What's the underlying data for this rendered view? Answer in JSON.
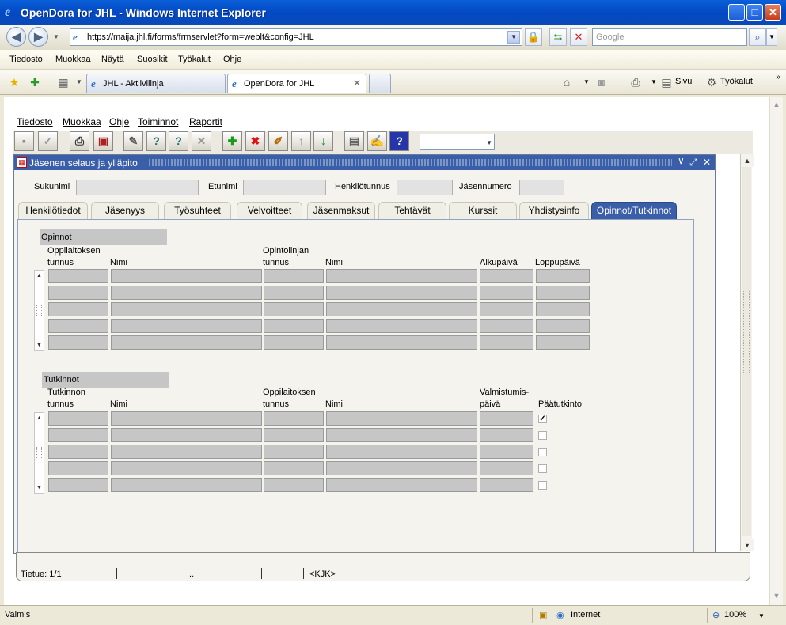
{
  "window": {
    "title": "OpenDora for JHL - Windows Internet Explorer"
  },
  "address": {
    "url": "https://maija.jhl.fi/forms/frmservlet?form=weblt&config=JHL",
    "search_placeholder": "Google"
  },
  "ie_menu": [
    "Tiedosto",
    "Muokkaa",
    "Näytä",
    "Suosikit",
    "Työkalut",
    "Ohje"
  ],
  "browser_tabs": [
    {
      "label": "JHL - Aktiivilinja"
    },
    {
      "label": "OpenDora for JHL"
    }
  ],
  "commands": {
    "page": "Sivu",
    "tools": "Työkalut"
  },
  "form_menu": [
    "Tiedosto",
    "Muokkaa",
    "Ohje",
    "Toiminnot",
    "Raportit"
  ],
  "inner_window": {
    "title": "Jäsenen selaus ja ylläpito"
  },
  "header_fields": [
    {
      "label": "Sukunimi"
    },
    {
      "label": "Etunimi"
    },
    {
      "label": "Henkilötunnus"
    },
    {
      "label": "Jäsennumero"
    }
  ],
  "form_tabs": [
    "Henkilötiedot",
    "Jäsenyys",
    "Työsuhteet",
    "Velvoitteet",
    "Jäsenmaksut",
    "Tehtävät",
    "Kurssit",
    "Yhdistysinfo",
    "Opinnot/Tutkinnot"
  ],
  "active_tab": "Opinnot/Tutkinnot",
  "opinnot": {
    "title": "Opinnot",
    "columns": [
      {
        "line1": "Oppilaitoksen",
        "line2": "tunnus"
      },
      {
        "line1": "",
        "line2": "Nimi"
      },
      {
        "line1": "Opintolinjan",
        "line2": "tunnus"
      },
      {
        "line1": "",
        "line2": "Nimi"
      },
      {
        "line1": "",
        "line2": "Alkupäivä"
      },
      {
        "line1": "",
        "line2": "Loppupäivä"
      }
    ]
  },
  "tutkinnot": {
    "title": "Tutkinnot",
    "columns": [
      {
        "line1": "Tutkinnon",
        "line2": "tunnus"
      },
      {
        "line1": "",
        "line2": "Nimi"
      },
      {
        "line1": "Oppilaitoksen",
        "line2": "tunnus"
      },
      {
        "line1": "",
        "line2": "Nimi"
      },
      {
        "line1": "Valmistumis-",
        "line2": "päivä"
      },
      {
        "line1": "",
        "line2": "Päätutkinto"
      }
    ],
    "paatutkinto_checked": [
      true,
      false,
      false,
      false,
      false
    ]
  },
  "form_status": {
    "record": "Tietue: 1/1",
    "ellipsis": "...",
    "mode": "<KJK>"
  },
  "ie_status": {
    "text": "Valmis",
    "zone": "Internet",
    "zoom": "100%"
  }
}
